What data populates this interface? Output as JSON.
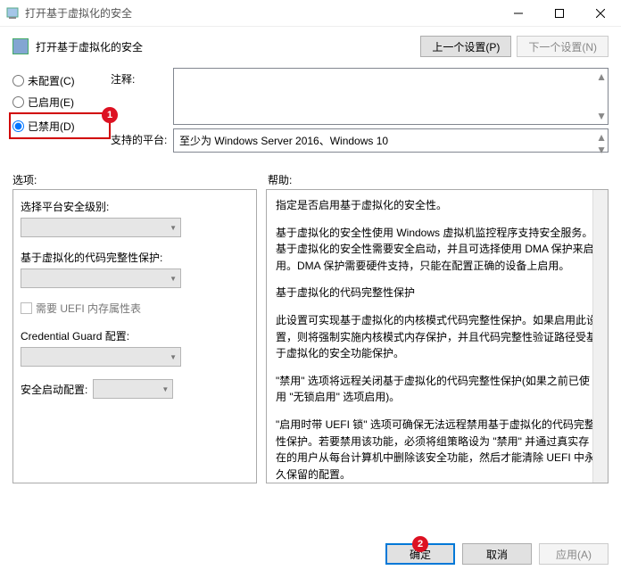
{
  "titlebar": {
    "title": "打开基于虚拟化的安全"
  },
  "header": {
    "title": "打开基于虚拟化的安全",
    "prev": "上一个设置(P)",
    "next": "下一个设置(N)"
  },
  "radios": {
    "not_configured": "未配置(C)",
    "enabled": "已启用(E)",
    "disabled": "已禁用(D)",
    "selected": "disabled"
  },
  "info": {
    "comment_label": "注释:",
    "comment_value": "",
    "platform_label": "支持的平台:",
    "platform_value": "至少为 Windows Server 2016、Windows 10"
  },
  "sections": {
    "options": "选项:",
    "help": "帮助:"
  },
  "options": {
    "platform_security_label": "选择平台安全级别:",
    "code_integrity_label": "基于虚拟化的代码完整性保护:",
    "uefi_checkbox": "需要 UEFI 内存属性表",
    "credential_guard_label": "Credential Guard 配置:",
    "secure_boot_label": "安全启动配置:"
  },
  "help": {
    "p1": "指定是否启用基于虚拟化的安全性。",
    "p2": "基于虚拟化的安全性使用 Windows 虚拟机监控程序支持安全服务。基于虚拟化的安全性需要安全启动，并且可选择使用 DMA 保护来启用。DMA 保护需要硬件支持，只能在配置正确的设备上启用。",
    "p3": "基于虚拟化的代码完整性保护",
    "p4": "此设置可实现基于虚拟化的内核模式代码完整性保护。如果启用此设置，则将强制实施内核模式内存保护，并且代码完整性验证路径受基于虚拟化的安全功能保护。",
    "p5": "\"禁用\" 选项将远程关闭基于虚拟化的代码完整性保护(如果之前已使用 \"无锁启用\" 选项启用)。",
    "p6": "\"启用时带 UEFI 锁\" 选项可确保无法远程禁用基于虚拟化的代码完整性保护。若要禁用该功能，必须将组策略设为 \"禁用\" 并通过真实存在的用户从每台计算机中删除该安全功能，然后才能清除 UEFI 中永久保留的配置。"
  },
  "buttons": {
    "ok": "确定",
    "cancel": "取消",
    "apply": "应用(A)"
  },
  "annotations": {
    "one": "1",
    "two": "2"
  }
}
